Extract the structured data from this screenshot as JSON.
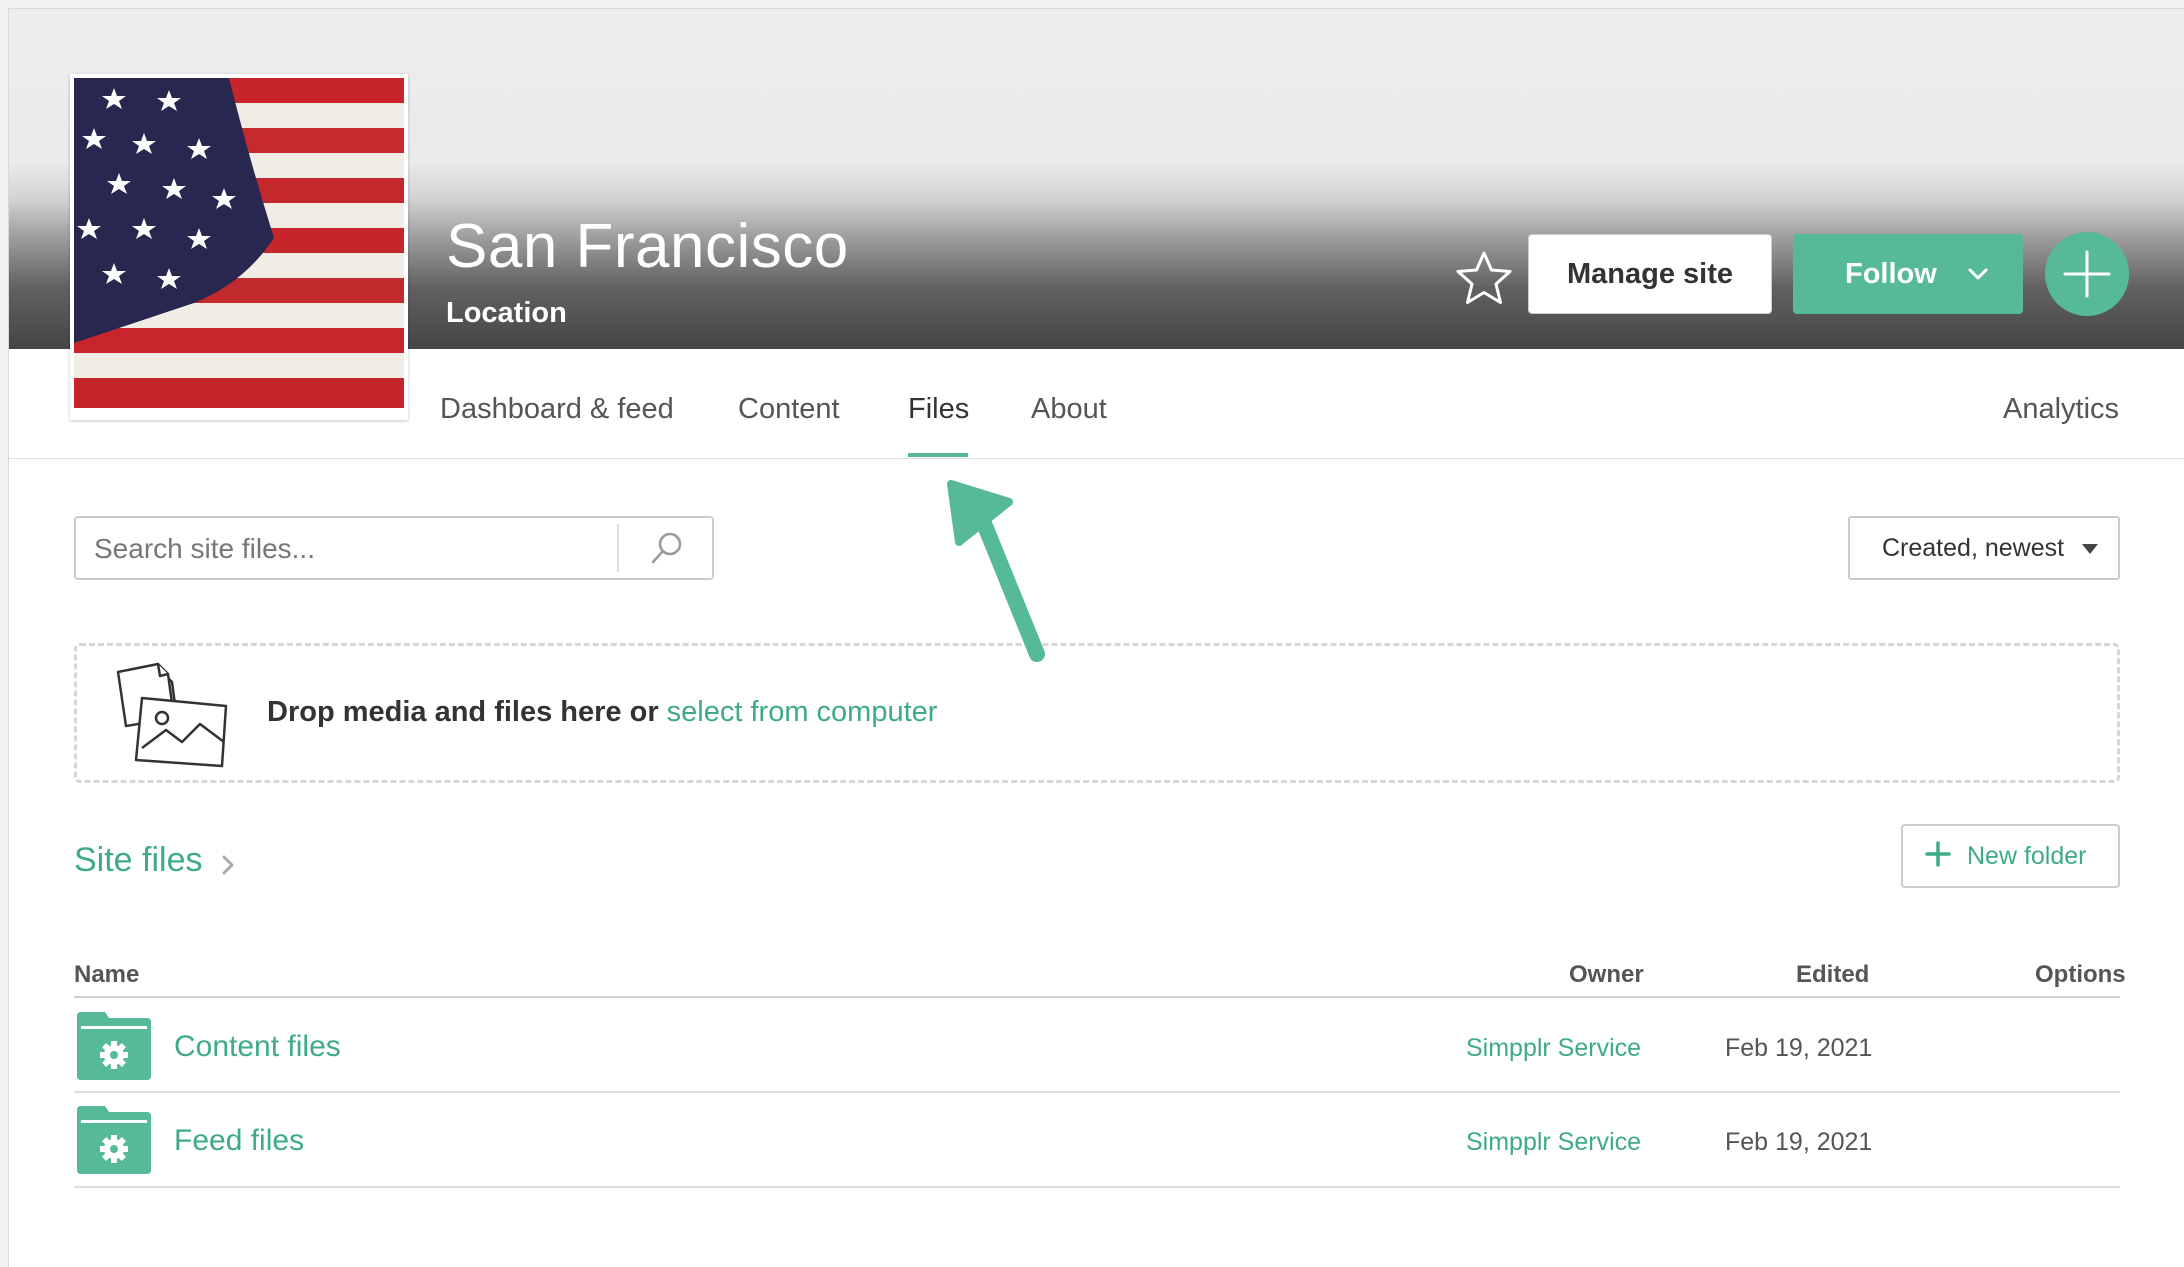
{
  "site": {
    "title": "San Francisco",
    "subtitle": "Location"
  },
  "actions": {
    "manage_label": "Manage site",
    "follow_label": "Follow"
  },
  "tabs": [
    {
      "label": "Dashboard & feed"
    },
    {
      "label": "Content"
    },
    {
      "label": "Files"
    },
    {
      "label": "About"
    },
    {
      "label": "Analytics"
    }
  ],
  "active_tab": "Files",
  "search": {
    "placeholder": "Search site files...",
    "value": ""
  },
  "sort": {
    "selected": "Created, newest"
  },
  "dropzone": {
    "text": "Drop media and files here or",
    "link": "select from computer"
  },
  "breadcrumb": {
    "label": "Site files"
  },
  "new_folder_label": "New folder",
  "table": {
    "headers": {
      "name": "Name",
      "owner": "Owner",
      "edited": "Edited",
      "options": "Options"
    },
    "rows": [
      {
        "name": "Content files",
        "owner": "Simpplr Service",
        "edited": "Feb 19, 2021"
      },
      {
        "name": "Feed files",
        "owner": "Simpplr Service",
        "edited": "Feb 19, 2021"
      }
    ]
  },
  "colors": {
    "accent": "#55b99a",
    "link": "#3faa8a",
    "text": "#333333"
  },
  "icons": {
    "favorite": "star-icon",
    "add": "plus-icon",
    "search": "magnifier-icon",
    "sort": "caret-down-icon",
    "upload": "files-image-icon",
    "folder": "folder-gear-icon",
    "breadcrumb": "chevron-right-icon"
  }
}
